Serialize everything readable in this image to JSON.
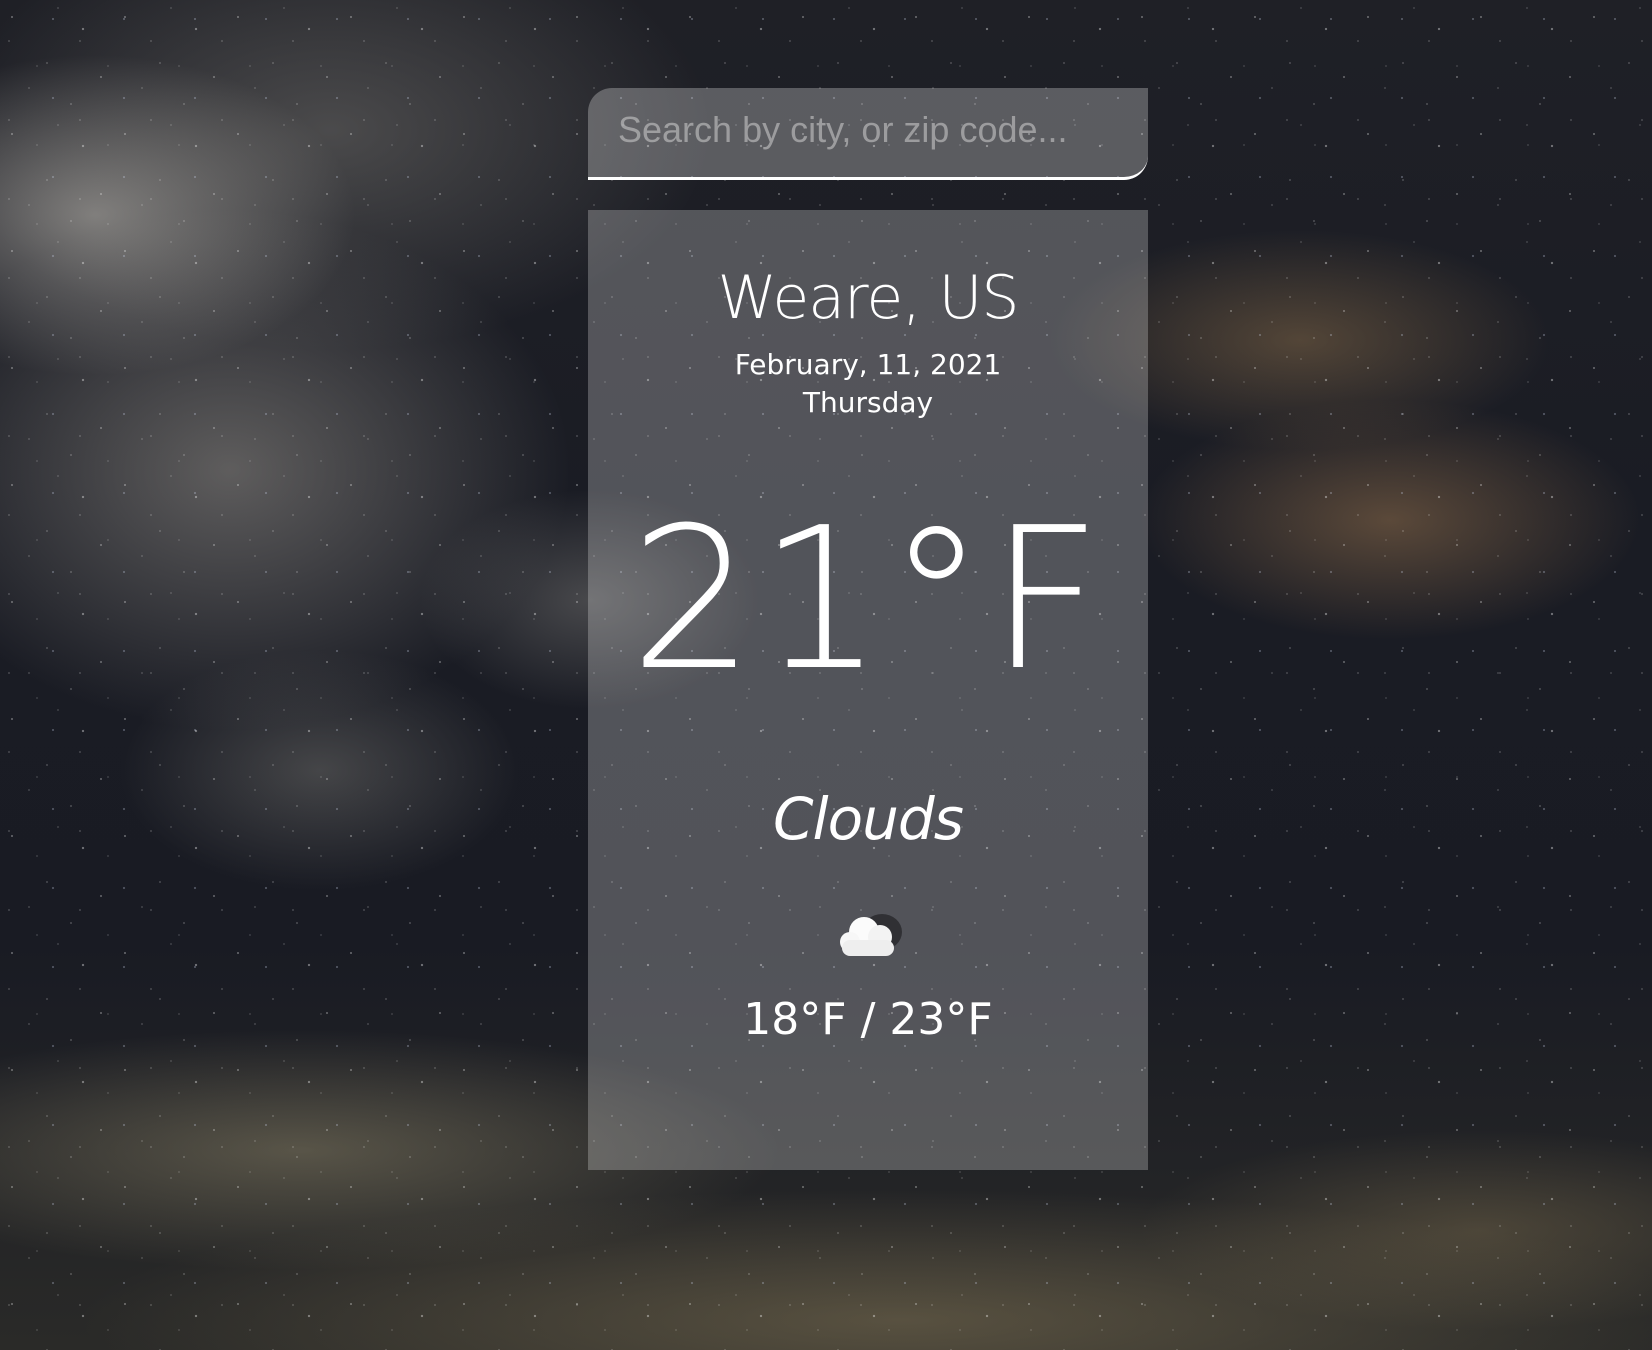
{
  "search": {
    "placeholder": "Search by city, or zip code...",
    "value": ""
  },
  "weather": {
    "location": "Weare, US",
    "date": "February, 11, 2021",
    "day": "Thursday",
    "temperature": "21°F",
    "condition": "Clouds",
    "condition_icon": "cloud-icon",
    "high_low": "18°F / 23°F"
  },
  "colors": {
    "text": "#ffffff",
    "search_underline": "#ffffff"
  }
}
